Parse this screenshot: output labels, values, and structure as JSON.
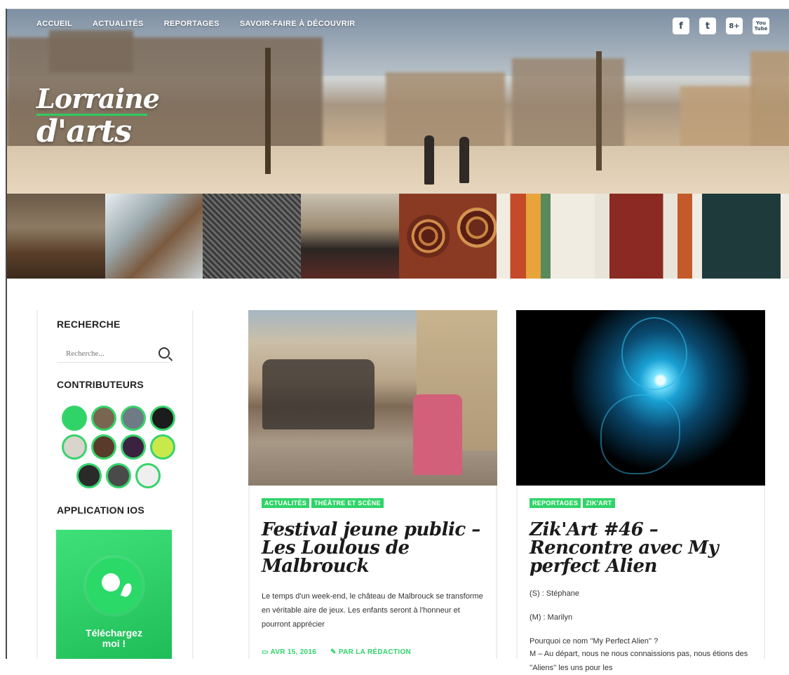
{
  "nav": {
    "items": [
      "ACCUEIL",
      "ACTUALITÉS",
      "REPORTAGES",
      "SAVOIR-FAIRE À DÉCOUVRIR"
    ]
  },
  "social": {
    "icons": [
      "facebook-icon",
      "twitter-icon",
      "google-plus-icon",
      "youtube-icon"
    ],
    "labels": [
      "f",
      "t",
      "8+",
      "You Tube"
    ]
  },
  "logo": {
    "line1": "Lorraine",
    "line2": "d'arts"
  },
  "sidebar": {
    "search_title": "RECHERCHE",
    "search_placeholder": "Recherche...",
    "contributors_title": "CONTRIBUTEURS",
    "app_title": "APPLICATION IOS",
    "app_cta": "Téléchargez moi !"
  },
  "articles": [
    {
      "tags": [
        "ACTUALITÉS",
        "THÉÂTRE ET SCÈNE"
      ],
      "title": "Festival jeune public – Les Loulous de Malbrouck",
      "excerpt": "Le temps d'un week-end, le château de Malbrouck se transforme en véritable aire de jeux. Les enfants seront à l'honneur et pourront apprécier",
      "date": "AVR 15, 2016",
      "author": "PAR LA RÉDACTION"
    },
    {
      "tags": [
        "REPORTAGES",
        "ZIK'ART"
      ],
      "title": "Zik'Art #46 – Rencontre avec My perfect Alien",
      "lines": [
        "(S) : Stéphane",
        "(M) : Marilyn",
        "Pourquoi ce nom ''My Perfect Alien'' ?",
        "M – Au départ, nous ne nous connaissions pas, nous étions des ''Aliens'' les uns pour les"
      ]
    }
  ],
  "colors": {
    "accent": "#2fd468",
    "text": "#1b1b1b"
  }
}
